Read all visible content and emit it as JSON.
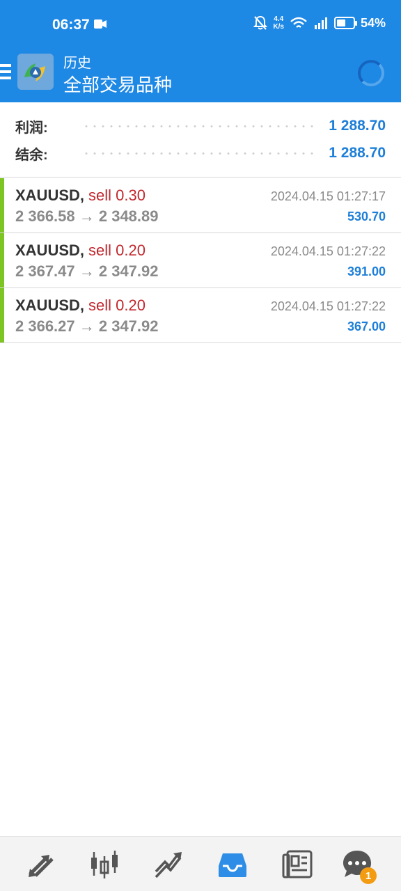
{
  "status_bar": {
    "time": "06:37",
    "network_speed_top": "4.4",
    "network_speed_bottom": "K/s",
    "battery": "54%",
    "battery_fraction": 0.54
  },
  "header": {
    "subtitle": "历史",
    "title": "全部交易品种"
  },
  "summary": {
    "profit_label": "利润:",
    "profit_value": "1 288.70",
    "balance_label": "结余:",
    "balance_value": "1 288.70"
  },
  "trades": [
    {
      "symbol": "XAUUSD,",
      "side": "sell 0.30",
      "prices": "2 366.58 → 2 348.89",
      "datetime": "2024.04.15 01:27:17",
      "profit": "530.70"
    },
    {
      "symbol": "XAUUSD,",
      "side": "sell 0.20",
      "prices": "2 367.47 → 2 347.92",
      "datetime": "2024.04.15 01:27:22",
      "profit": "391.00"
    },
    {
      "symbol": "XAUUSD,",
      "side": "sell 0.20",
      "prices": "2 366.27 → 2 347.92",
      "datetime": "2024.04.15 01:27:22",
      "profit": "367.00"
    }
  ],
  "bottom_nav": {
    "items": [
      "quotes-icon",
      "chart-icon",
      "trade-icon",
      "history-icon",
      "news-icon",
      "chat-icon"
    ],
    "active": "history-icon",
    "chat_badge": "1"
  },
  "colors": {
    "header_blue": "#1e88e5",
    "value_blue": "#1e7fd8",
    "sell_red": "#c1272d",
    "accent_green": "#7cc522",
    "badge_orange": "#f39c12"
  }
}
